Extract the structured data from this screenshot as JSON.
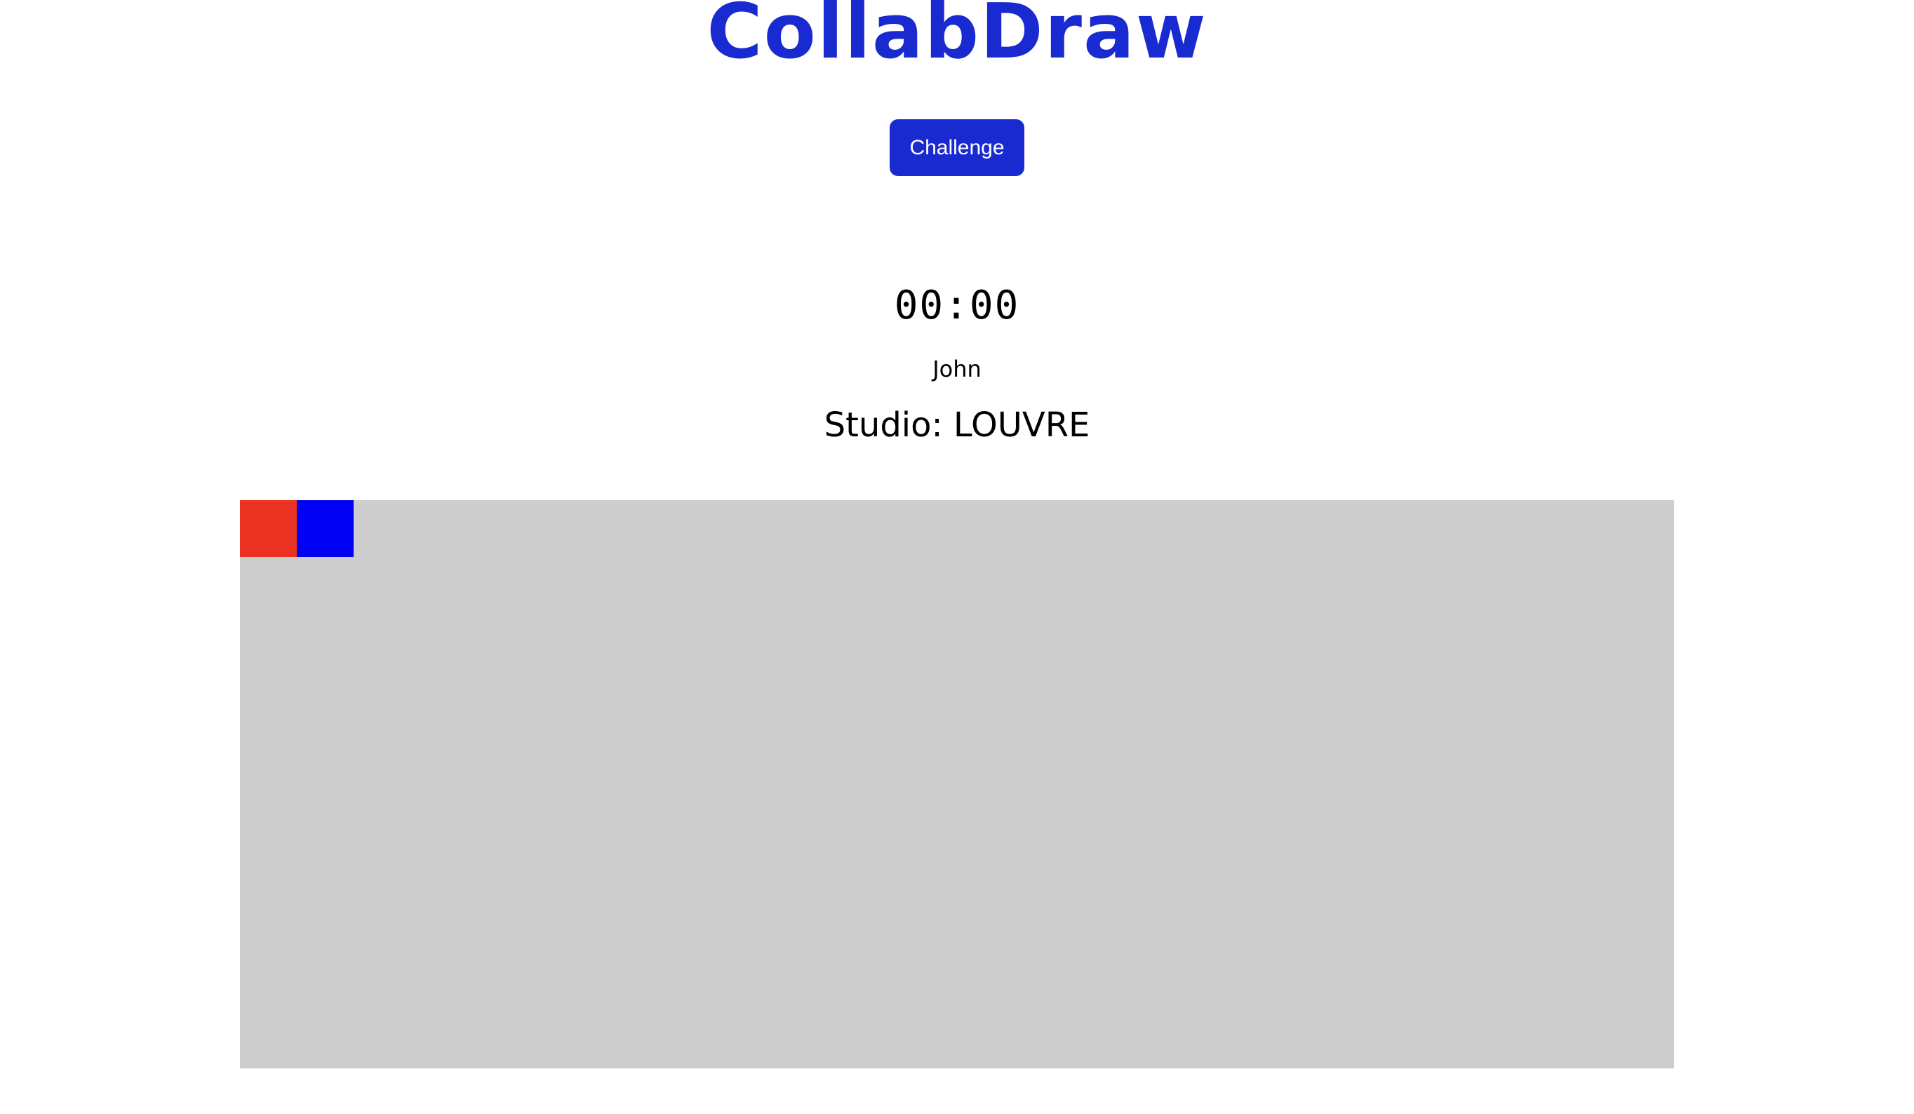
{
  "app": {
    "title": "CollabDraw"
  },
  "toolbar": {
    "challenge_label": "Challenge"
  },
  "game": {
    "timer": "00:00",
    "player_name": "John",
    "studio_label": "Studio: LOUVRE"
  },
  "canvas": {
    "background_color": "#cdcdcd",
    "cells": [
      {
        "color": "#ea3323",
        "name": "red"
      },
      {
        "color": "#0000f5",
        "name": "blue"
      }
    ]
  },
  "colors": {
    "accent": "#1a2ad1",
    "text": "#000000",
    "background": "#ffffff"
  }
}
